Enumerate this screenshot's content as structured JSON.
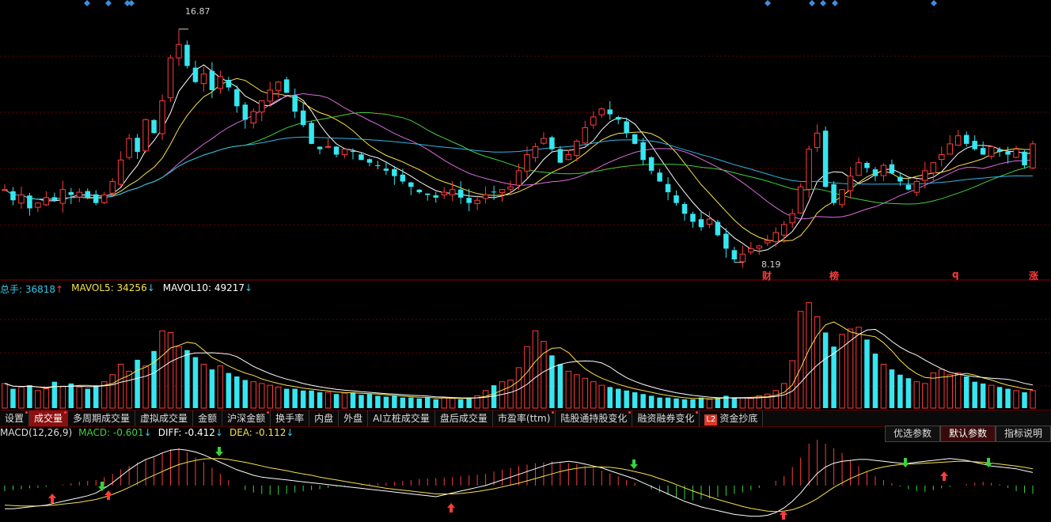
{
  "colors": {
    "up": "#ff3b3b",
    "down": "#36e6f0",
    "ma5": "#ffffff",
    "ma10": "#f6e24a",
    "ma20": "#d96be0",
    "ma30": "#3fd13f",
    "ma60": "#2fb7e6",
    "grid": "#6a0000",
    "vol_label": "#36c9e6",
    "mavol5": "#f6e24a",
    "mavol10": "#ffffff",
    "diff_line": "#ffffff",
    "dea_line": "#f6e24a",
    "macd_green": "#36d33f"
  },
  "price": {
    "high_label": "16.87",
    "low_label": "8.19"
  },
  "badges": [
    {
      "text": "财"
    },
    {
      "text": "榜"
    },
    {
      "text": "q"
    },
    {
      "text": "涨"
    }
  ],
  "volume": {
    "total_label": "总手: 36818",
    "total_arrow": "↑",
    "mavol5_label": "MAVOL5: 34256",
    "mavol5_arrow": "↓",
    "mavol10_label": "MAVOL10: 49217",
    "mavol10_arrow": "↓"
  },
  "tabs": [
    {
      "label": "设置",
      "dot": true
    },
    {
      "label": "成交量",
      "dot": true,
      "active": true
    },
    {
      "label": "多周期成交量"
    },
    {
      "label": "虚拟成交量"
    },
    {
      "label": "金额"
    },
    {
      "label": "沪深金额",
      "dot": true
    },
    {
      "label": "换手率"
    },
    {
      "label": "内盘"
    },
    {
      "label": "外盘"
    },
    {
      "label": "AI立桩成交量"
    },
    {
      "label": "盘后成交量"
    },
    {
      "label": "市盈率(ttm)",
      "dot": true
    },
    {
      "label": "陆股通持股变化",
      "dot": true
    },
    {
      "label": "融资融券变化",
      "dot": true
    },
    {
      "label": "资金抄底",
      "l2": "L2"
    }
  ],
  "macd": {
    "title": "MACD(12,26,9)",
    "macd_label": "MACD: -0.601",
    "macd_arrow": "↓",
    "diff_label": "DIFF: -0.412",
    "diff_arrow": "↓",
    "dea_label": "DEA: -0.112",
    "dea_arrow": "↓",
    "buttons": [
      {
        "label": "优选参数"
      },
      {
        "label": "默认参数",
        "active": true
      },
      {
        "label": "指标说明"
      }
    ]
  },
  "chart_data": {
    "type": "candlestick",
    "closes": [
      10.9,
      10.5,
      10.7,
      10.2,
      10.4,
      10.6,
      10.5,
      10.9,
      10.7,
      10.8,
      10.6,
      10.4,
      10.7,
      11.2,
      12.0,
      12.8,
      12.3,
      13.5,
      13.0,
      14.2,
      15.8,
      16.3,
      15.5,
      14.9,
      15.2,
      14.6,
      15.1,
      14.7,
      14.0,
      13.5,
      13.8,
      14.2,
      14.6,
      14.9,
      14.5,
      13.8,
      13.3,
      12.6,
      12.4,
      12.5,
      12.2,
      12.4,
      12.3,
      12.0,
      11.9,
      11.8,
      11.6,
      11.4,
      11.2,
      11.0,
      10.8,
      10.7,
      10.6,
      10.8,
      10.9,
      10.6,
      10.4,
      10.5,
      10.7,
      10.8,
      10.9,
      11.0,
      11.6,
      12.2,
      12.5,
      12.8,
      12.4,
      11.9,
      12.2,
      12.7,
      13.2,
      13.6,
      13.9,
      13.7,
      13.5,
      13.0,
      12.6,
      12.0,
      11.6,
      11.2,
      10.8,
      10.4,
      10.0,
      9.7,
      9.5,
      9.8,
      9.2,
      8.7,
      8.3,
      8.5,
      8.7,
      8.8,
      9.0,
      9.3,
      9.6,
      10.0,
      11.0,
      12.4,
      13.0,
      11.0,
      10.4,
      10.9,
      11.4,
      11.9,
      11.7,
      11.4,
      11.8,
      11.5,
      11.2,
      10.9,
      11.2,
      11.6,
      11.9,
      12.2,
      12.6,
      12.9,
      12.6,
      12.4,
      12.2,
      12.5,
      12.3,
      12.2,
      12.4,
      11.8,
      12.6
    ],
    "vols": [
      28,
      22,
      24,
      26,
      20,
      22,
      30,
      25,
      28,
      24,
      22,
      26,
      30,
      38,
      50,
      42,
      55,
      48,
      65,
      88,
      86,
      70,
      66,
      58,
      50,
      44,
      48,
      40,
      36,
      32,
      30,
      28,
      26,
      24,
      22,
      22,
      20,
      20,
      18,
      18,
      16,
      17,
      18,
      15,
      16,
      14,
      13,
      14,
      12,
      12,
      11,
      12,
      10,
      12,
      11,
      10,
      12,
      14,
      20,
      26,
      30,
      32,
      46,
      70,
      88,
      76,
      60,
      50,
      42,
      38,
      34,
      30,
      26,
      24,
      22,
      20,
      18,
      16,
      14,
      12,
      12,
      11,
      10,
      10,
      12,
      10,
      12,
      14,
      12,
      12,
      11,
      14,
      16,
      20,
      28,
      54,
      110,
      120,
      104,
      86,
      70,
      84,
      90,
      92,
      78,
      62,
      50,
      44,
      38,
      34,
      30,
      28,
      40,
      44,
      38,
      40,
      36,
      30,
      28,
      26,
      24,
      22,
      20,
      18,
      20
    ],
    "macd_hist": [
      -0.12,
      -0.1,
      -0.08,
      -0.06,
      -0.05,
      -0.03,
      0.0,
      0.02,
      0.05,
      0.08,
      0.1,
      0.12,
      0.18,
      0.25,
      0.35,
      0.42,
      0.5,
      0.55,
      0.6,
      0.7,
      0.78,
      0.8,
      0.72,
      0.6,
      0.5,
      0.38,
      0.25,
      0.12,
      0.0,
      -0.1,
      -0.15,
      -0.18,
      -0.2,
      -0.2,
      -0.18,
      -0.15,
      -0.12,
      -0.1,
      -0.08,
      -0.05,
      -0.03,
      -0.02,
      0.0,
      0.02,
      0.04,
      0.05,
      0.06,
      0.08,
      0.1,
      0.12,
      0.14,
      0.15,
      0.16,
      0.17,
      0.18,
      0.2,
      0.22,
      0.23,
      0.25,
      0.3,
      0.34,
      0.38,
      0.42,
      0.45,
      0.48,
      0.5,
      0.52,
      0.5,
      0.48,
      0.46,
      0.42,
      0.38,
      0.32,
      0.26,
      0.2,
      0.12,
      0.06,
      0.0,
      -0.08,
      -0.15,
      -0.2,
      -0.26,
      -0.3,
      -0.32,
      -0.3,
      -0.28,
      -0.25,
      -0.22,
      -0.18,
      -0.15,
      -0.1,
      -0.05,
      0.0,
      0.1,
      0.2,
      0.4,
      0.6,
      0.9,
      1.0,
      0.9,
      0.8,
      0.7,
      0.55,
      0.42,
      0.3,
      0.2,
      0.12,
      0.05,
      -0.02,
      -0.08,
      -0.12,
      -0.14,
      -0.1,
      -0.06,
      -0.03,
      0.0,
      0.03,
      0.06,
      0.08,
      0.06,
      0.03,
      -0.05,
      -0.12,
      -0.16,
      -0.18
    ],
    "diff": [
      -0.5,
      -0.5,
      -0.48,
      -0.46,
      -0.44,
      -0.42,
      -0.38,
      -0.34,
      -0.3,
      -0.26,
      -0.22,
      -0.16,
      -0.06,
      0.06,
      0.2,
      0.34,
      0.46,
      0.56,
      0.62,
      0.7,
      0.76,
      0.78,
      0.76,
      0.72,
      0.66,
      0.58,
      0.5,
      0.42,
      0.34,
      0.28,
      0.22,
      0.18,
      0.16,
      0.14,
      0.12,
      0.1,
      0.08,
      0.06,
      0.04,
      0.02,
      0.0,
      -0.02,
      -0.04,
      -0.06,
      -0.08,
      -0.1,
      -0.12,
      -0.14,
      -0.16,
      -0.18,
      -0.2,
      -0.22,
      -0.24,
      -0.2,
      -0.16,
      -0.12,
      -0.08,
      -0.04,
      0.0,
      0.06,
      0.12,
      0.18,
      0.24,
      0.3,
      0.36,
      0.42,
      0.48,
      0.5,
      0.52,
      0.5,
      0.46,
      0.42,
      0.38,
      0.32,
      0.26,
      0.2,
      0.14,
      0.06,
      -0.02,
      -0.1,
      -0.18,
      -0.26,
      -0.34,
      -0.4,
      -0.46,
      -0.5,
      -0.54,
      -0.58,
      -0.62,
      -0.64,
      -0.66,
      -0.66,
      -0.64,
      -0.58,
      -0.48,
      -0.34,
      -0.16,
      0.06,
      0.26,
      0.4,
      0.48,
      0.52,
      0.54,
      0.56,
      0.56,
      0.54,
      0.52,
      0.5,
      0.48,
      0.48,
      0.5,
      0.52,
      0.54,
      0.56,
      0.58,
      0.56,
      0.54,
      0.5,
      0.46,
      0.42,
      0.4,
      0.38,
      0.36,
      0.32,
      0.28
    ],
    "dea": [
      -0.42,
      -0.43,
      -0.44,
      -0.44,
      -0.44,
      -0.43,
      -0.42,
      -0.4,
      -0.38,
      -0.36,
      -0.33,
      -0.3,
      -0.25,
      -0.19,
      -0.12,
      -0.04,
      0.05,
      0.14,
      0.22,
      0.3,
      0.38,
      0.45,
      0.5,
      0.54,
      0.57,
      0.58,
      0.58,
      0.56,
      0.53,
      0.5,
      0.46,
      0.42,
      0.38,
      0.35,
      0.32,
      0.28,
      0.25,
      0.22,
      0.18,
      0.15,
      0.12,
      0.09,
      0.06,
      0.03,
      0.0,
      -0.03,
      -0.06,
      -0.08,
      -0.1,
      -0.12,
      -0.14,
      -0.16,
      -0.18,
      -0.18,
      -0.18,
      -0.17,
      -0.15,
      -0.13,
      -0.1,
      -0.07,
      -0.03,
      0.01,
      0.05,
      0.1,
      0.15,
      0.2,
      0.25,
      0.3,
      0.34,
      0.37,
      0.39,
      0.4,
      0.4,
      0.39,
      0.37,
      0.34,
      0.3,
      0.26,
      0.21,
      0.15,
      0.09,
      0.02,
      -0.05,
      -0.12,
      -0.18,
      -0.24,
      -0.3,
      -0.35,
      -0.4,
      -0.45,
      -0.49,
      -0.52,
      -0.55,
      -0.56,
      -0.55,
      -0.52,
      -0.46,
      -0.38,
      -0.28,
      -0.16,
      -0.04,
      0.06,
      0.15,
      0.23,
      0.3,
      0.36,
      0.4,
      0.43,
      0.45,
      0.46,
      0.47,
      0.48,
      0.49,
      0.5,
      0.51,
      0.52,
      0.52,
      0.51,
      0.5,
      0.48,
      0.46,
      0.44,
      0.42,
      0.39,
      0.36
    ]
  }
}
